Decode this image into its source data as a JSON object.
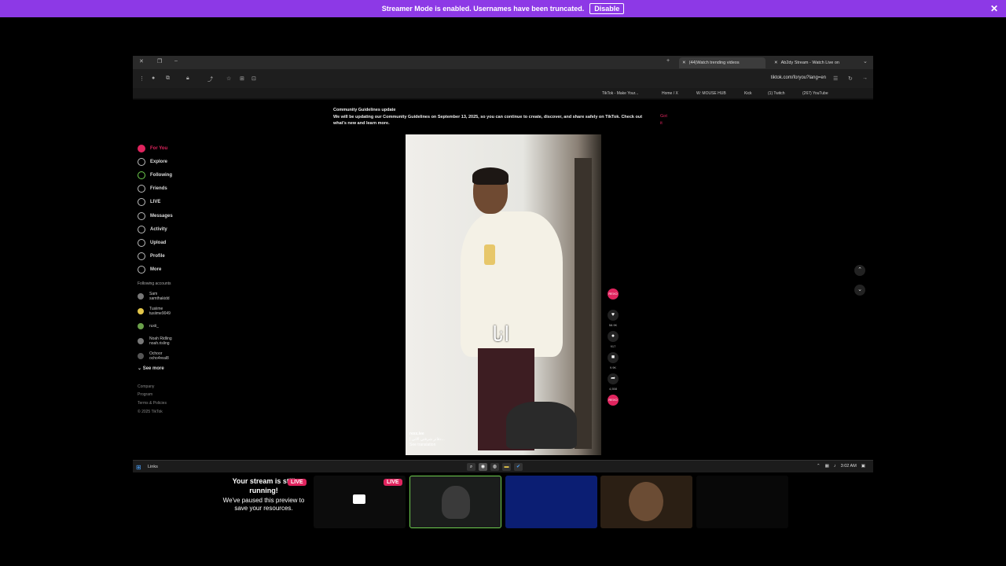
{
  "banner": {
    "message": "Streamer Mode is enabled. Usernames have been truncated.",
    "disable_label": "Disable",
    "close_icon": "✕"
  },
  "browser": {
    "tabs": [
      {
        "label": "(44)Watch trending videos"
      },
      {
        "label": "Ab2dy Stream - Watch Live on"
      }
    ],
    "url": "tiktok.com/foryou?lang=en",
    "bookmarks": [
      "TikTok - Make Your...",
      "Home / X",
      "W: MOUSE HUB",
      "Kick",
      "(1) Twitch",
      "(267) YouTube"
    ]
  },
  "notice": {
    "title": "Community Guidelines update",
    "body": "We will be updating our Community Guidelines on September 13, 2025, so you can continue to create, discover, and share safely on TikTok. Check out what's new and learn more.",
    "got_it": "Got it"
  },
  "sidebar": {
    "nav": [
      {
        "label": "For You",
        "icon": "home-icon",
        "selected": true
      },
      {
        "label": "Explore",
        "icon": "compass-icon"
      },
      {
        "label": "Following",
        "icon": "following-icon"
      },
      {
        "label": "Friends",
        "icon": "friends-icon"
      },
      {
        "label": "LIVE",
        "icon": "live-icon"
      },
      {
        "label": "Messages",
        "icon": "messages-icon"
      },
      {
        "label": "Activity",
        "icon": "activity-icon"
      },
      {
        "label": "Upload",
        "icon": "upload-icon"
      },
      {
        "label": "Profile",
        "icon": "profile-icon"
      },
      {
        "label": "More",
        "icon": "more-icon"
      }
    ],
    "following_heading": "Following accounts",
    "accounts": [
      {
        "name": "Sam",
        "handle": "samthakidd"
      },
      {
        "name": "Tusiime",
        "handle": "tusiime9049"
      },
      {
        "name": "ruxii_",
        "handle": ""
      },
      {
        "name": "Noah Ridling",
        "handle": "noah.risling"
      },
      {
        "name": "Ochoor",
        "handle": "ocho4real8"
      }
    ],
    "see_more": "See more",
    "footer": [
      "Company",
      "Program",
      "Terms & Policies",
      "© 2025 TikTok"
    ]
  },
  "video": {
    "overlay_text": "انا",
    "author": "rexx.lee",
    "caption": "| دفاتر شرفتي الاتى...",
    "see_translation": "See translation"
  },
  "actions": {
    "likes": "58.9K",
    "comments": "917",
    "saves": "9.9K",
    "shares": "4,558"
  },
  "taskbar": {
    "label": "Links",
    "time": "3:02 AM"
  },
  "previews": {
    "title": "Your stream is still running!",
    "subtitle": "We've paused this preview to save your resources.",
    "live_badge": "LIVE"
  },
  "colors": {
    "banner": "#8d39e6",
    "accent": "#e0245e",
    "live": "#e0245e",
    "selected_border": "#6fcf4f"
  }
}
